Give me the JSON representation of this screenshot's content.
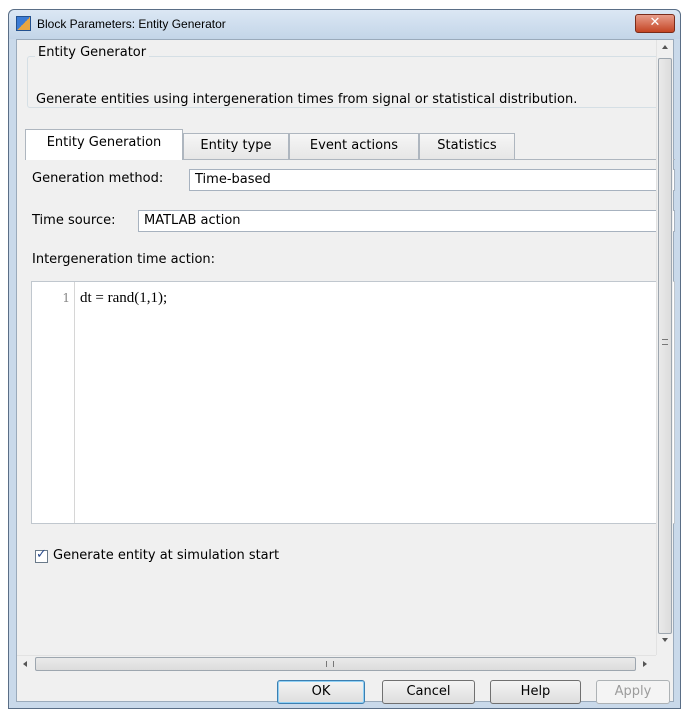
{
  "window": {
    "title": "Block Parameters: Entity Generator",
    "close_label": "✕"
  },
  "block": {
    "group_title": "Entity Generator",
    "description": "Generate entities using intergeneration times from signal or statistical distribution."
  },
  "tabs": [
    {
      "label": "Entity Generation",
      "active": true
    },
    {
      "label": "Entity type",
      "active": false
    },
    {
      "label": "Event actions",
      "active": false
    },
    {
      "label": "Statistics",
      "active": false
    }
  ],
  "form": {
    "generation_method_label": "Generation method:",
    "generation_method_value": "Time-based",
    "time_source_label": "Time source:",
    "time_source_value": "MATLAB action",
    "action_label": "Intergeneration time action:",
    "editor_line_number": "1",
    "editor_code": "dt = rand(1,1);",
    "checkbox_label": "Generate entity at simulation start",
    "checkbox_checked": true
  },
  "scrollbar": {
    "h_grip": "III"
  },
  "buttons": {
    "ok_label": "OK",
    "cancel_label": "Cancel",
    "help_label": "Help",
    "apply_label": "Apply"
  },
  "colors": {
    "titlebar": "#c9d9ea",
    "close_button": "#c44524",
    "client": "#f0f0f0"
  }
}
